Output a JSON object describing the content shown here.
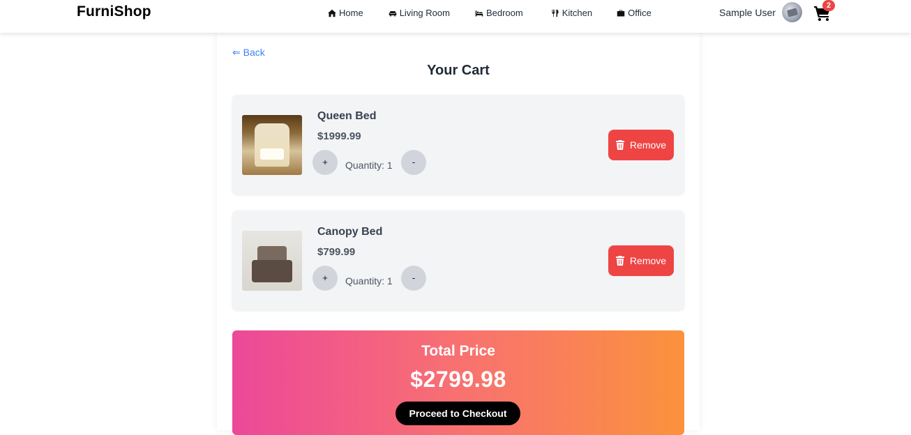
{
  "header": {
    "brand": "FurniShop",
    "nav": [
      {
        "label": "Home",
        "icon": "home-icon"
      },
      {
        "label": "Living Room",
        "icon": "couch-icon"
      },
      {
        "label": "Bedroom",
        "icon": "bed-icon"
      },
      {
        "label": "Kitchen",
        "icon": "utensils-icon"
      },
      {
        "label": "Office",
        "icon": "briefcase-icon"
      }
    ],
    "user_name": "Sample User",
    "cart_count": "2"
  },
  "page": {
    "back_label": "⇐ Back",
    "title": "Your Cart"
  },
  "cart": {
    "items": [
      {
        "name": "Queen Bed",
        "price": "$1999.99",
        "quantity_label": "Quantity: 1",
        "plus_label": "+",
        "minus_label": "-",
        "remove_label": "Remove"
      },
      {
        "name": "Canopy Bed",
        "price": "$799.99",
        "quantity_label": "Quantity: 1",
        "plus_label": "+",
        "minus_label": "-",
        "remove_label": "Remove"
      }
    ]
  },
  "summary": {
    "total_label": "Total Price",
    "total_amount": "$2799.98",
    "checkout_label": "Proceed to Checkout"
  },
  "colors": {
    "accent_link": "#3b82f6",
    "remove_button": "#ef4444",
    "gradient_start": "#ec4899",
    "gradient_end": "#fb923c"
  }
}
